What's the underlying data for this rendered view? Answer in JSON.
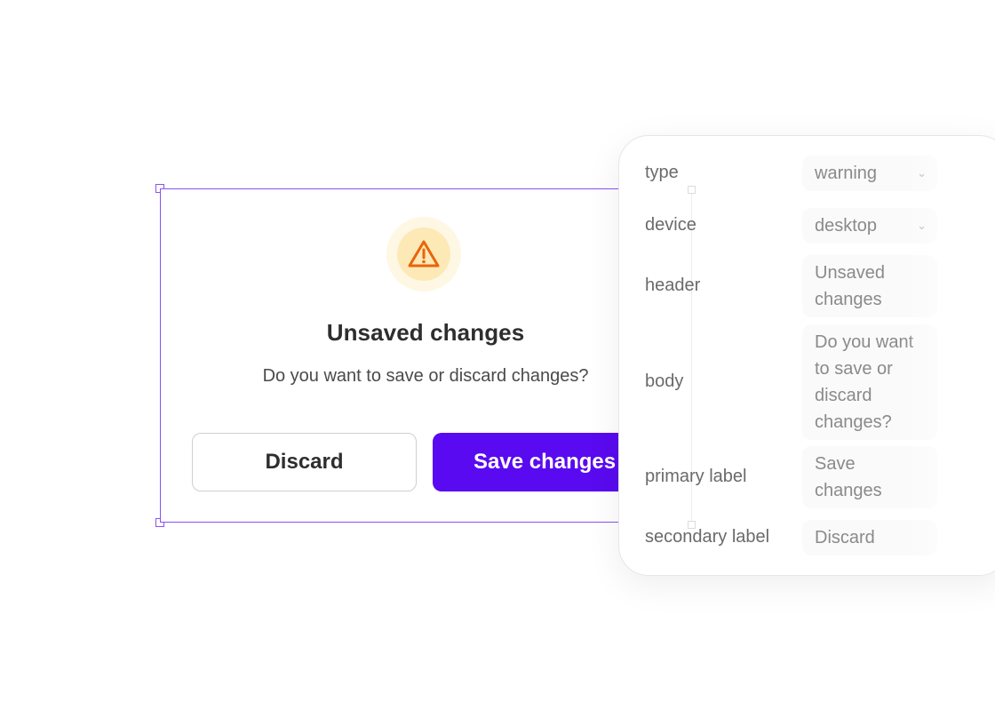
{
  "dialog": {
    "title": "Unsaved changes",
    "body": "Do you want to save or discard changes?",
    "secondary_button": "Discard",
    "primary_button": "Save changes",
    "icon": "warning-triangle-icon"
  },
  "properties": {
    "type": {
      "label": "type",
      "value": "warning"
    },
    "device": {
      "label": "device",
      "value": "desktop"
    },
    "header": {
      "label": "header",
      "value": "Unsaved changes"
    },
    "body": {
      "label": "body",
      "value": "Do you want to save or discard changes?"
    },
    "primary_label": {
      "label": "primary label",
      "value": "Save changes"
    },
    "secondary_label": {
      "label": "secondary label",
      "value": "Discard"
    }
  },
  "colors": {
    "selection_outline": "#8a52f0",
    "primary_button": "#5a0af0",
    "warning_icon": "#e8650c",
    "warning_bg_outer": "#fef7e4",
    "warning_bg_inner": "#fde9b6"
  }
}
